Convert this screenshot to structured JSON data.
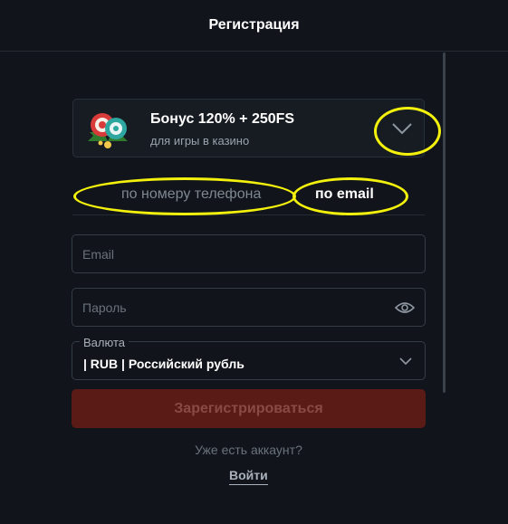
{
  "header": {
    "title": "Регистрация"
  },
  "bonus": {
    "title": "Бонус 120% + 250FS",
    "subtitle": "для игры в казино",
    "art_icon": "casino-chips-icon"
  },
  "tabs": [
    {
      "label": "по номеру телефона",
      "active": false
    },
    {
      "label": "по email",
      "active": true
    }
  ],
  "form": {
    "email_placeholder": "Email",
    "password_placeholder": "Пароль",
    "currency_label": "Валюта",
    "currency_value": "| RUB | Российский рубль",
    "submit_label": "Зарегистрироваться"
  },
  "footer": {
    "have_account": "Уже есть аккаунт?",
    "login_label": "Войти"
  },
  "colors": {
    "background": "#11151b",
    "submit_disabled": "#5a1b17",
    "annotation": "#f4f10c"
  }
}
